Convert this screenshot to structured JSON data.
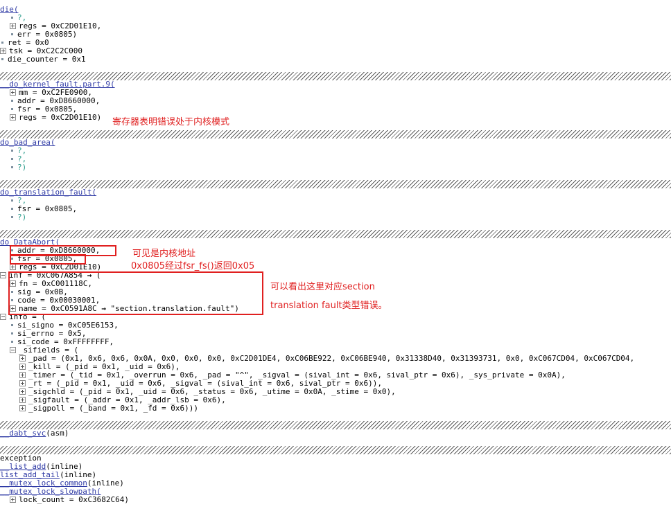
{
  "frames": {
    "die": {
      "name": "die(",
      "arg_q": "?,",
      "regs": "regs = 0xC2D01E10,",
      "err": "err = 0x0805)",
      "ret": "ret = 0x0",
      "tsk": "tsk = 0xC2C2C000",
      "die_counter": "die_counter = 0x1"
    },
    "kernel_fault": {
      "name": "__do_kernel_fault.part.9(",
      "mm": "mm = 0xC2FE0900,",
      "addr": "addr = 0xD8660000,",
      "fsr": "fsr = 0x0805,",
      "regs": "regs = 0xC2D01E10)"
    },
    "bad_area": {
      "name": "do_bad_area(",
      "q1": "?,",
      "q2": "?,",
      "q3": "?)"
    },
    "translation_fault": {
      "name": "do_translation_fault(",
      "q1": "?,",
      "fsr": "fsr = 0x0805,",
      "q2": "?)"
    },
    "data_abort": {
      "name": "do_DataAbort(",
      "addr": "addr = 0xD8660000,",
      "fsr": "fsr = 0x0805,",
      "regs": "regs = 0xC2D01E10)",
      "inf": "inf = 0xC067A854 ",
      "inf_tail": " (",
      "fn": "fn = 0xC001118C,",
      "sig": "sig = 0x0B,",
      "code": "code = 0x00030001,",
      "name_field": "name = 0xC0591A8C ",
      "name_tail": " \"section.translation.fault\")",
      "info": "info = (",
      "si_signo": "si_signo = 0xC05E6153,",
      "si_errno": "si_errno = 0x5,",
      "si_code": "si_code = 0xFFFFFFFF,",
      "sifields": "_sifields = (",
      "pad": "_pad = (0x1, 0x6, 0x6, 0x0A, 0x0, 0x0, 0x0, 0xC2D01DE4, 0xC06BE922, 0xC06BE940, 0x31338D40, 0x31393731, 0x0, 0xC067CD04, 0xC067CD04,",
      "kill": "_kill = (_pid = 0x1, _uid = 0x6),",
      "timer": "_timer = (_tid = 0x1, _overrun = 0x6, _pad = \"^\", _sigval = (sival_int = 0x6, sival_ptr = 0x6), _sys_private = 0x0A),",
      "rt": "_rt = (_pid = 0x1, _uid = 0x6, _sigval = (sival_int = 0x6, sival_ptr = 0x6)),",
      "sigchld": "_sigchld = (_pid = 0x1, _uid = 0x6, _status = 0x6, _utime = 0x0A, _stime = 0x0),",
      "sigfault": "_sigfault = (_addr = 0x1, _addr_lsb = 0x6),",
      "sigpoll": "_sigpoll = (_band = 0x1, _fd = 0x6)))"
    },
    "dabt_svc": {
      "name": "__dabt_svc",
      "tail": "(asm)"
    },
    "tail": {
      "exception": "exception",
      "list_add": "__list_add",
      "list_add_tail_fn": "list_add_tail",
      "mutex_common": "__mutex_lock_common",
      "inline": "(inline)",
      "mutex_slowpath": "__mutex_lock_slowpath(",
      "lock_count": "lock_count = 0xC3682C64)"
    }
  },
  "annotations": {
    "regs_note": "寄存器表明错误处于内核模式",
    "addr_note": "可见是内核地址",
    "fsr_note": "0x0805经过fsr_fs()返回0x05",
    "section_note_1": "可以看出这里对应section",
    "section_note_2": "translation fault类型错误。"
  },
  "colors": {
    "function_name": "#2f3aa5",
    "unknown_arg": "#2a9b8a",
    "annotation": "#e02020"
  },
  "icons": {
    "arrow": "→"
  }
}
